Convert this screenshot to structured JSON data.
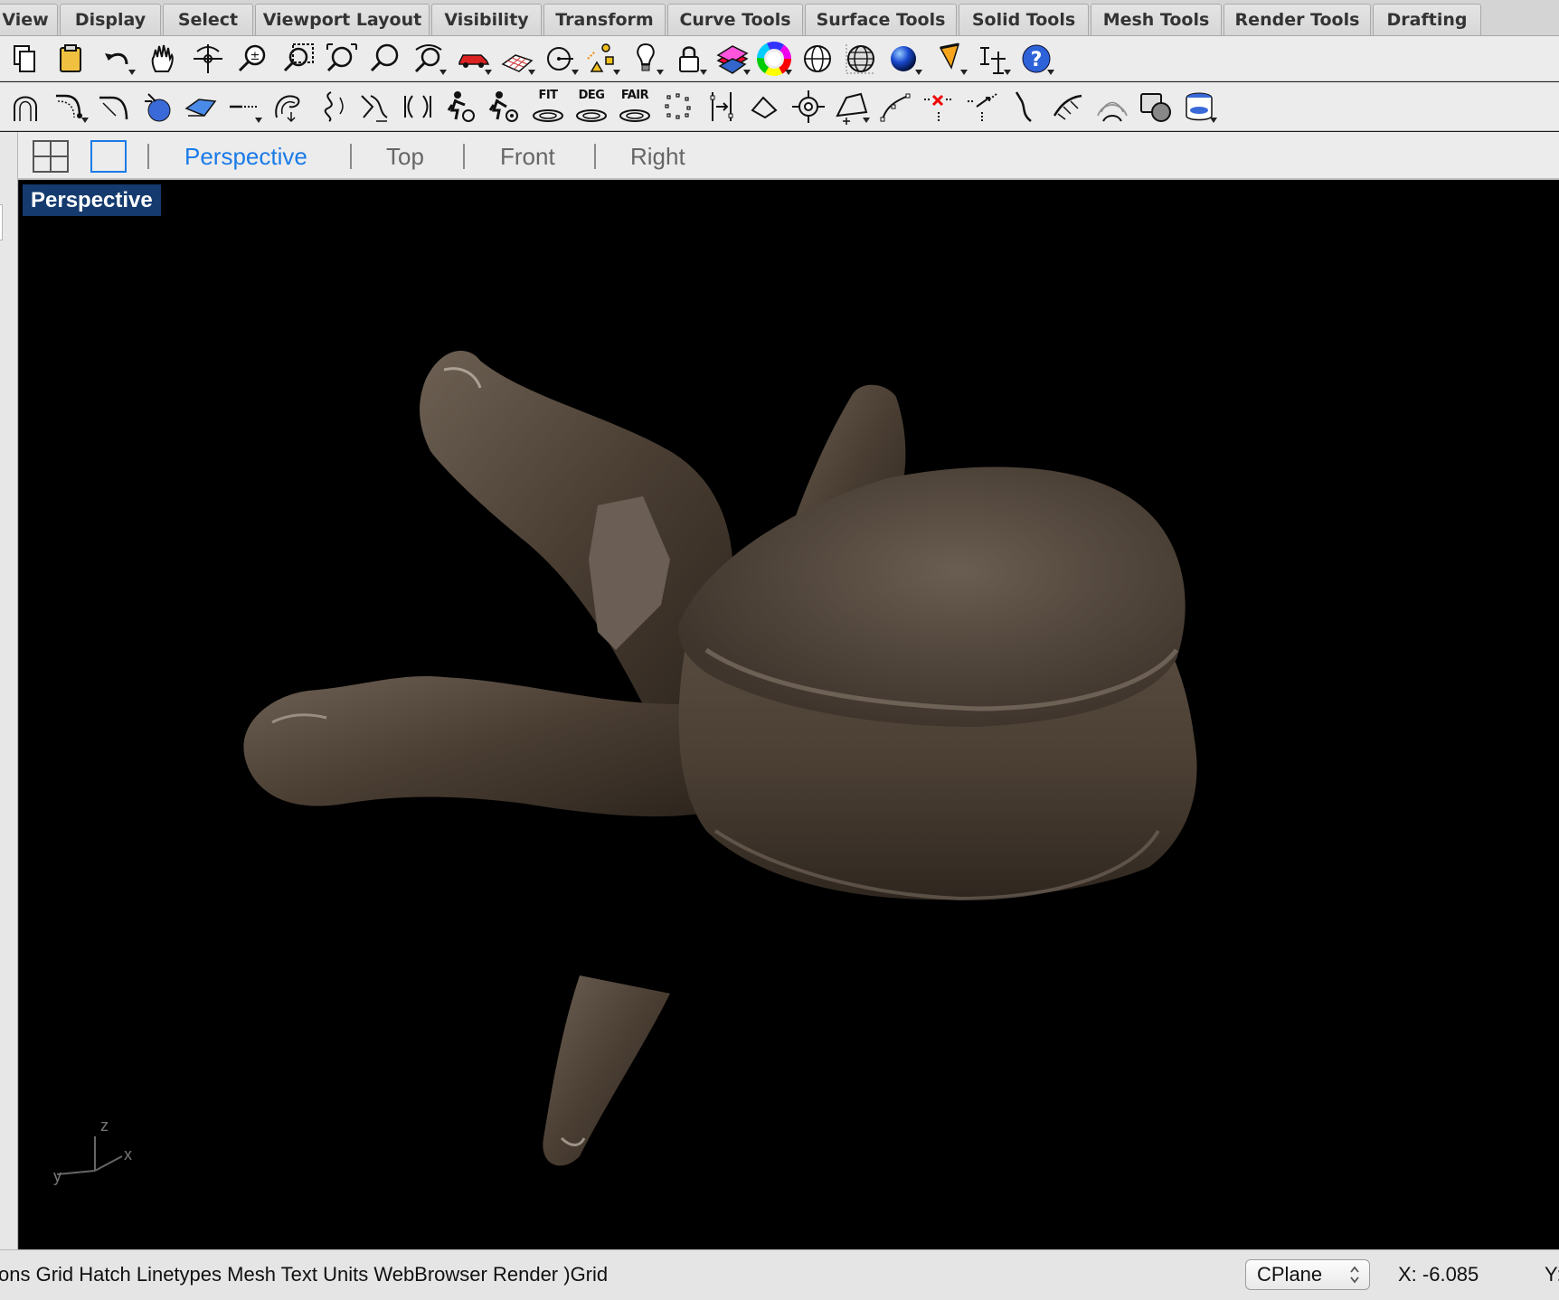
{
  "menu_tabs": [
    "View",
    "Display",
    "Select",
    "Viewport Layout",
    "Visibility",
    "Transform",
    "Curve Tools",
    "Surface Tools",
    "Solid Tools",
    "Mesh Tools",
    "Render Tools",
    "Drafting"
  ],
  "toolbar2": {
    "fit_label": "FIT",
    "deg_label": "DEG",
    "fair_label": "FAIR"
  },
  "viewport_tabs": {
    "active": "Perspective",
    "items": [
      "Perspective",
      "Top",
      "Front",
      "Right"
    ]
  },
  "viewport": {
    "label": "Perspective"
  },
  "axes": {
    "z": "z",
    "y": "y",
    "x": "x"
  },
  "status": {
    "command_text": "ons Grid Hatch Linetypes Mesh Text Units WebBrowser Render )Grid",
    "cplane": "CPlane",
    "x_coord": "X: -6.085",
    "y_coord": "Y:"
  },
  "colors": {
    "accent": "#1a7be8",
    "viewport_label_bg": "#143a6e",
    "viewport_bg": "#000000"
  }
}
